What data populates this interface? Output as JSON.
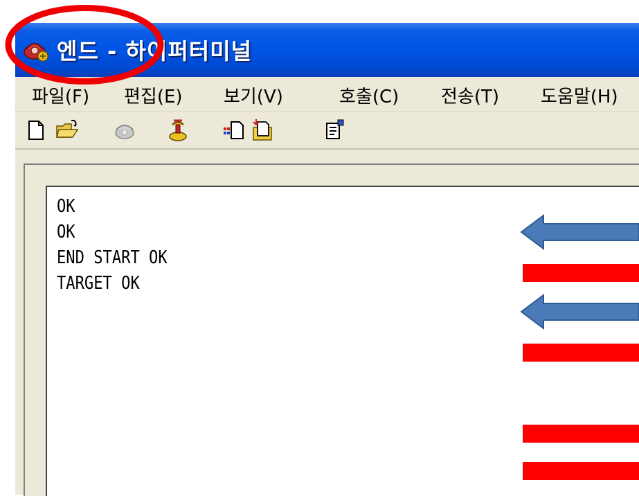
{
  "window": {
    "title": "엔드 - 하이퍼터미널",
    "app_icon": "hyperterminal-phone-icon"
  },
  "menu": [
    {
      "label": "파일(F)"
    },
    {
      "label": "편집(E)"
    },
    {
      "label": "보기(V)"
    },
    {
      "label": "호출(C)"
    },
    {
      "label": "전송(T)"
    },
    {
      "label": "도움말(H)"
    }
  ],
  "toolbar": {
    "icons": [
      "new-document-icon",
      "open-folder-icon",
      "disconnected-phone-icon",
      "call-phone-icon",
      "send-file-icon",
      "receive-file-icon",
      "properties-icon"
    ]
  },
  "terminal": {
    "lines": [
      "OK",
      "OK",
      "END START OK",
      "TARGET OK"
    ]
  },
  "annotations": {
    "ellipse_color": "#ee0000",
    "arrow_color": "#4a7ab8",
    "bar_color": "#ff0000"
  }
}
